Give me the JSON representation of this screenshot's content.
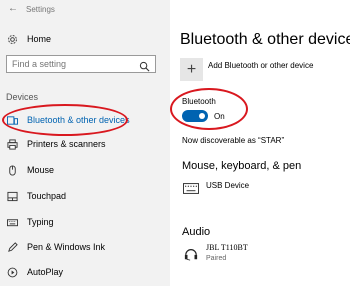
{
  "window": {
    "title": "Settings"
  },
  "sidebar": {
    "home_label": "Home",
    "search_placeholder": "Find a setting",
    "section_label": "Devices",
    "items": [
      {
        "label": "Bluetooth & other devices",
        "icon": "bluetooth-devices-icon",
        "selected": true
      },
      {
        "label": "Printers & scanners",
        "icon": "printer-icon"
      },
      {
        "label": "Mouse",
        "icon": "mouse-icon"
      },
      {
        "label": "Touchpad",
        "icon": "touchpad-icon"
      },
      {
        "label": "Typing",
        "icon": "keyboard-icon"
      },
      {
        "label": "Pen & Windows Ink",
        "icon": "pen-icon"
      },
      {
        "label": "AutoPlay",
        "icon": "autoplay-icon"
      }
    ]
  },
  "main": {
    "title": "Bluetooth & other devices",
    "add_device_label": "Add Bluetooth or other device",
    "bluetooth": {
      "label": "Bluetooth",
      "state": "On",
      "on": true
    },
    "discoverable_text": "Now discoverable as “STAR”",
    "mouse_section": {
      "heading": "Mouse, keyboard, & pen",
      "devices": [
        {
          "name": "USB Device"
        }
      ]
    },
    "audio_section": {
      "heading": "Audio",
      "devices": [
        {
          "name": "JBL T110BT",
          "status": "Paired"
        }
      ]
    }
  },
  "colors": {
    "accent": "#0063b1",
    "annotation": "#d9181f",
    "sidebar_bg": "#f2f2f2"
  }
}
